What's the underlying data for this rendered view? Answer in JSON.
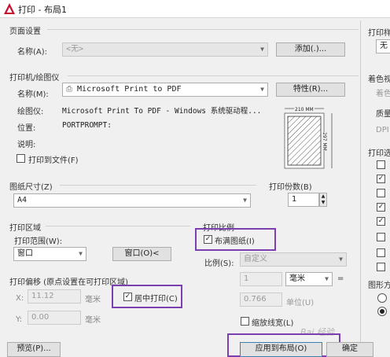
{
  "window": {
    "title": "打印 - 布局1"
  },
  "page_setup": {
    "group": "页面设置",
    "name_label": "名称(A):",
    "name_value": "<无>",
    "add_button": "添加(.)..."
  },
  "printer": {
    "group": "打印机/绘图仪",
    "name_label": "名称(M):",
    "name_value": "Microsoft Print to PDF",
    "properties_button": "特性(R)...",
    "plotter_label": "绘图仪:",
    "plotter_value": "Microsoft Print To PDF - Windows 系统驱动程...",
    "location_label": "位置:",
    "location_value": "PORTPROMPT:",
    "desc_label": "说明:",
    "print_to_file": "打印到文件(F)",
    "preview_width": "210 MM",
    "preview_height": "297 MM"
  },
  "paper_size": {
    "group": "图纸尺寸(Z)",
    "value": "A4"
  },
  "copies": {
    "group": "打印份数(B)",
    "value": "1"
  },
  "print_area": {
    "group": "打印区域",
    "range_label": "打印范围(W):",
    "range_value": "窗口",
    "window_button": "窗口(O)<"
  },
  "plot_offset": {
    "group": "打印偏移 (原点设置在可打印区域)",
    "x_label": "X:",
    "x_value": "11.12",
    "y_label": "Y:",
    "y_value": "0.00",
    "unit1": "毫米",
    "unit2": "毫米",
    "center_label": "居中打印(C)"
  },
  "plot_scale": {
    "group": "打印比例",
    "fit_label": "布满图纸(I)",
    "scale_label": "比例(S):",
    "scale_value": "自定义",
    "value1": "1",
    "unit_value": "毫米",
    "equals": "=",
    "value2": "0.766",
    "unit2_label": "单位(U)",
    "lineweights_label": "缩放线宽(L)"
  },
  "right_panel": {
    "g1_label": "打印样",
    "g1_value": "无",
    "g2_label": "着色视",
    "g2_sub": "着色",
    "quality_label": "质量",
    "dpi_label": "DPI",
    "g3_label": "打印选",
    "g4_label": "图形方"
  },
  "footer": {
    "preview_button": "预览(P)...",
    "apply_button": "应用到布局(O)",
    "ok_button": "确定",
    "watermark": "Bai 经验"
  }
}
